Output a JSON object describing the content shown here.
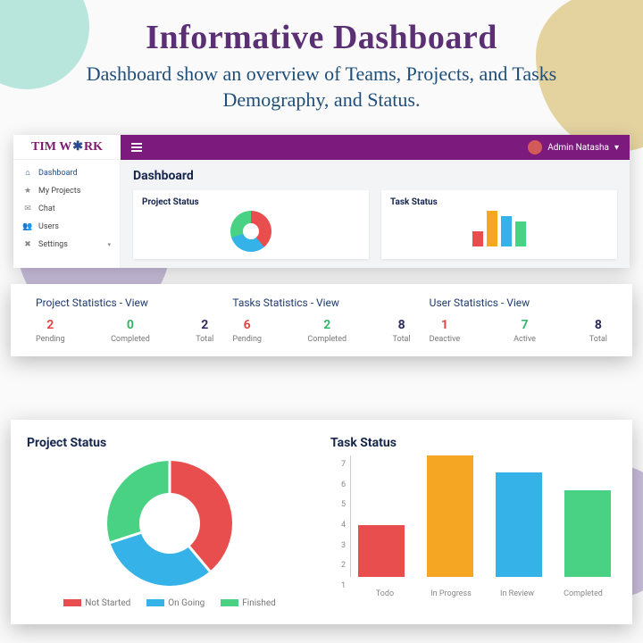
{
  "hero": {
    "title": "Informative Dashboard",
    "subtitle": "Dashboard show an overview of Teams, Projects, and Tasks Demography, and Status."
  },
  "logo": {
    "pre": "TIM W",
    "post": "RK"
  },
  "user_name": "Admin Natasha",
  "sidebar": {
    "items": [
      {
        "icon": "home-icon",
        "glyph": "⌂",
        "label": "Dashboard",
        "active": true
      },
      {
        "icon": "star-icon",
        "glyph": "★",
        "label": "My Projects"
      },
      {
        "icon": "chat-icon",
        "glyph": "✉",
        "label": "Chat"
      },
      {
        "icon": "users-icon",
        "glyph": "👥",
        "label": "Users"
      },
      {
        "icon": "gear-icon",
        "glyph": "✖",
        "label": "Settings",
        "caret": "▾"
      }
    ]
  },
  "page_title": "Dashboard",
  "stats": [
    {
      "title": "Project Statistics - View",
      "items": [
        {
          "num": "2",
          "label": "Pending",
          "cls": "red"
        },
        {
          "num": "0",
          "label": "Completed",
          "cls": "grn"
        },
        {
          "num": "2",
          "label": "Total",
          "cls": "dk"
        }
      ]
    },
    {
      "title": "Tasks Statistics - View",
      "items": [
        {
          "num": "6",
          "label": "Pending",
          "cls": "red"
        },
        {
          "num": "2",
          "label": "Completed",
          "cls": "grn"
        },
        {
          "num": "8",
          "label": "Total",
          "cls": "dk"
        }
      ]
    },
    {
      "title": "User Statistics - View",
      "items": [
        {
          "num": "1",
          "label": "Deactive",
          "cls": "red"
        },
        {
          "num": "7",
          "label": "Active",
          "cls": "grn"
        },
        {
          "num": "8",
          "label": "Total",
          "cls": "dk"
        }
      ]
    }
  ],
  "project_status": {
    "title": "Project Status",
    "legend": [
      {
        "label": "Not Started",
        "color": "#e94e4e"
      },
      {
        "label": "On Going",
        "color": "#35b2e8"
      },
      {
        "label": "Finished",
        "color": "#4ad284"
      }
    ]
  },
  "task_status": {
    "title": "Task Status",
    "ymax": 7,
    "ticks": [
      "7",
      "6",
      "5",
      "4",
      "3",
      "2",
      "1"
    ],
    "bars": [
      {
        "label": "Todo",
        "value": 3,
        "color": "#e94e4e"
      },
      {
        "label": "In Progress",
        "value": 7,
        "color": "#f5a623"
      },
      {
        "label": "In Review",
        "value": 6,
        "color": "#35b2e8"
      },
      {
        "label": "Completed",
        "value": 5,
        "color": "#4ad284"
      }
    ]
  },
  "chart_data": [
    {
      "type": "pie",
      "title": "Project Status",
      "categories": [
        "Not Started",
        "On Going",
        "Finished"
      ],
      "values": [
        39,
        31,
        30
      ],
      "colors": [
        "#e94e4e",
        "#35b2e8",
        "#4ad284"
      ]
    },
    {
      "type": "bar",
      "title": "Task Status",
      "categories": [
        "Todo",
        "In Progress",
        "In Review",
        "Completed"
      ],
      "values": [
        3,
        7,
        6,
        5
      ],
      "colors": [
        "#e94e4e",
        "#f5a623",
        "#35b2e8",
        "#4ad284"
      ],
      "ylim": [
        0,
        7
      ]
    }
  ]
}
